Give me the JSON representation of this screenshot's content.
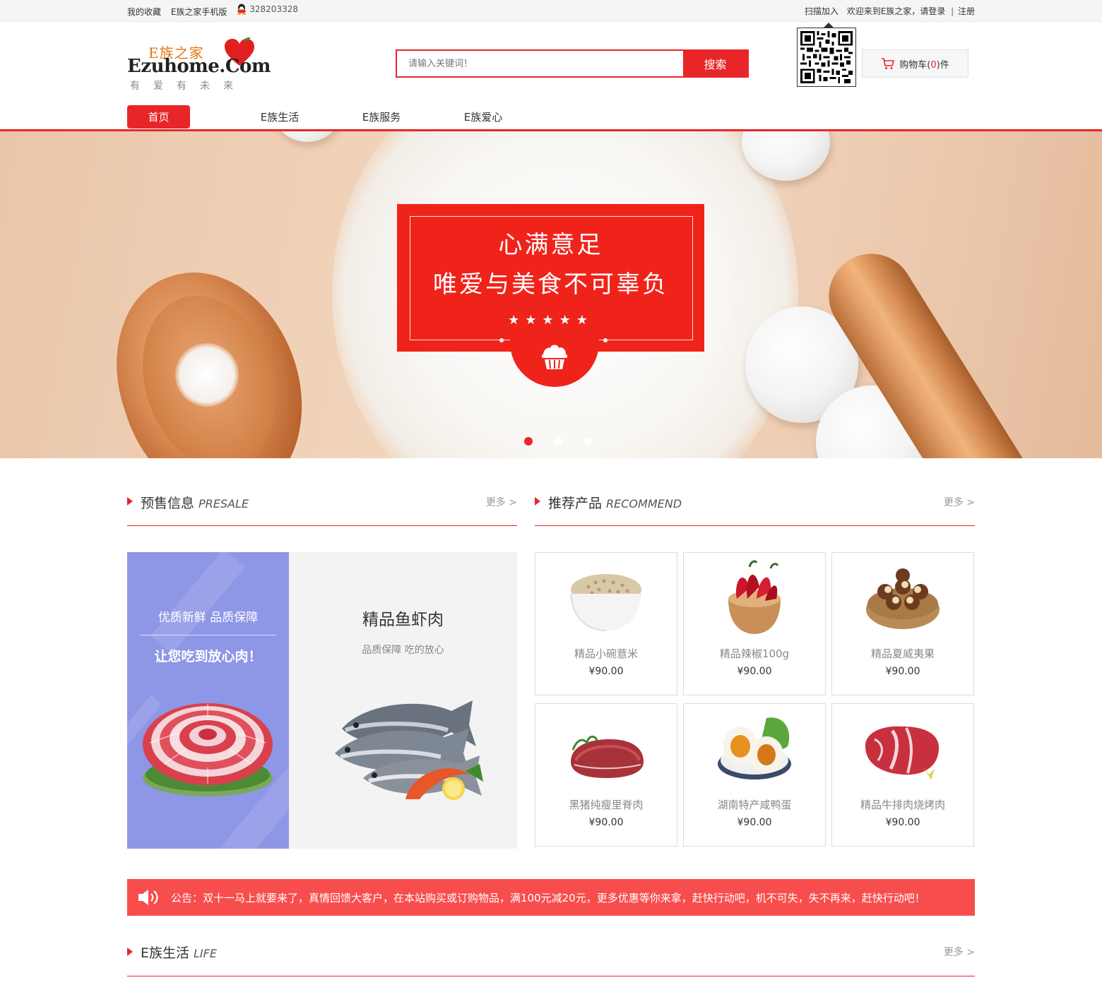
{
  "topbar": {
    "favorites": "我的收藏",
    "mobile": "E族之家手机版",
    "qq": "328203328",
    "scan_join": "扫描加入",
    "welcome": "欢迎来到E族之家，请登录",
    "separator": "|",
    "register": "注册"
  },
  "logo": {
    "cn": "E族之家",
    "en": "Ezuhome.Com",
    "slogan": "有爱有未来"
  },
  "search": {
    "placeholder": "请输入关键词！",
    "button": "搜索"
  },
  "cart": {
    "prefix": "购物车(",
    "count": "0",
    "suffix": ")件"
  },
  "nav": {
    "items": [
      "首页",
      "E族生活",
      "E族服务",
      "E族爱心"
    ],
    "active_index": 0
  },
  "banner": {
    "line1": "心满意足",
    "line2": "唯爱与美食不可辜负",
    "stars": "★★★★★",
    "slides": 3,
    "active_slide": 0
  },
  "presale": {
    "title": "预售信息",
    "title_en": "PRESALE",
    "more": "更多 >",
    "left_line1": "优质新鲜 品质保障",
    "left_line2": "让您吃到放心肉！",
    "right_title": "精品鱼虾肉",
    "right_subtitle": "品质保障 吃的放心"
  },
  "recommend": {
    "title": "推荐产品",
    "title_en": "RECOMMEND",
    "more": "更多 >",
    "products": [
      {
        "name": "精品小碗薏米",
        "price": "¥90.00"
      },
      {
        "name": "精品辣椒100g",
        "price": "¥90.00"
      },
      {
        "name": "精品夏威夷果",
        "price": "¥90.00"
      },
      {
        "name": "黑猪纯瘦里脊肉",
        "price": "¥90.00"
      },
      {
        "name": "湖南特产咸鸭蛋",
        "price": "¥90.00"
      },
      {
        "name": "精品牛排肉烧烤肉",
        "price": "¥90.00"
      }
    ]
  },
  "notice": {
    "text": "公告：双十一马上就要来了，真情回馈大客户，在本站购买或订购物品，满100元减20元，更多优惠等你来拿，赶快行动吧，机不可失，失不再来，赶快行动吧！"
  },
  "life": {
    "title": "E族生活",
    "title_en": "LIFE",
    "more": "更多 >"
  },
  "colors": {
    "accent": "#e8262a",
    "promo_red": "#f0231b",
    "presale_blue": "#8e96e6",
    "notice_bg": "#f84d4d"
  },
  "icons": [
    "qq-icon",
    "heart-icon",
    "qrcode-icon",
    "cart-icon",
    "cake-icon",
    "speaker-icon"
  ]
}
